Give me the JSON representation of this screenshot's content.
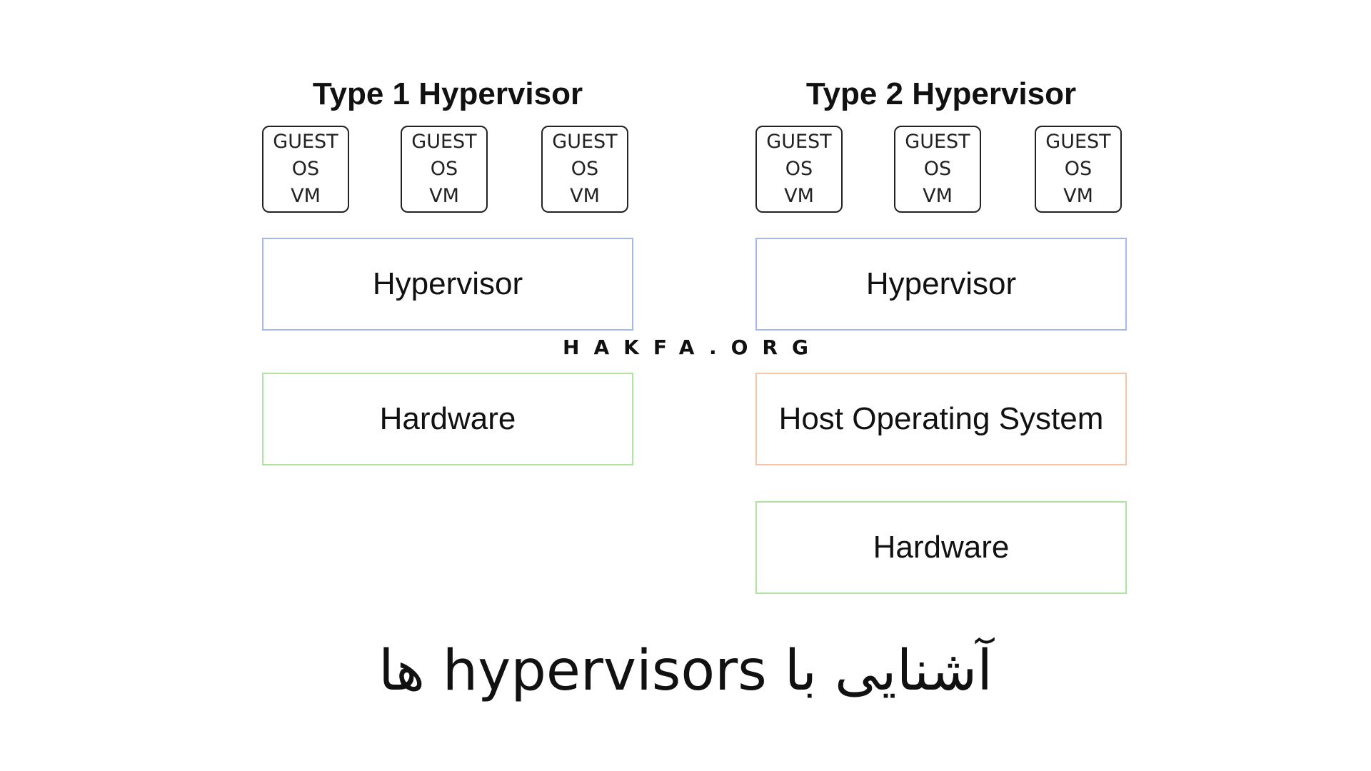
{
  "type1": {
    "title": "Type 1 Hypervisor",
    "vms": [
      {
        "line1": "GUEST",
        "line2": "OS",
        "line3": "VM"
      },
      {
        "line1": "GUEST",
        "line2": "OS",
        "line3": "VM"
      },
      {
        "line1": "GUEST",
        "line2": "OS",
        "line3": "VM"
      }
    ],
    "layers": [
      "Hypervisor",
      "Hardware"
    ]
  },
  "type2": {
    "title": "Type 2 Hypervisor",
    "vms": [
      {
        "line1": "GUEST",
        "line2": "OS",
        "line3": "VM"
      },
      {
        "line1": "GUEST",
        "line2": "OS",
        "line3": "VM"
      },
      {
        "line1": "GUEST",
        "line2": "OS",
        "line3": "VM"
      }
    ],
    "layers": [
      "Hypervisor",
      "Host Operating System",
      "Hardware"
    ]
  },
  "watermark": "HAKFA.ORG",
  "caption": "آشنایی با hypervisors ها",
  "colors": {
    "hypervisor_border": "#a6b6f4",
    "hardware_border": "#aee3a2",
    "host_os_border": "#f6c4a6",
    "vm_border": "#222222"
  }
}
